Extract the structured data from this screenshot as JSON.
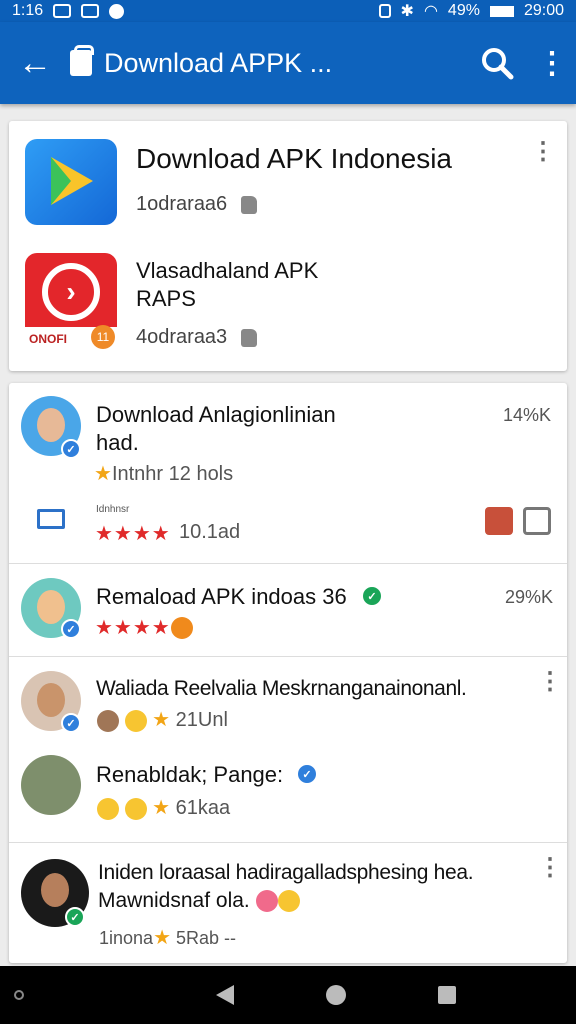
{
  "status_bar": {
    "time": "1:16",
    "battery": "49%",
    "clock_right": "29:00"
  },
  "app_bar": {
    "title": "Download APPK ..."
  },
  "featured": [
    {
      "title": "Download APK Indonesia",
      "sub": "1odraraa6"
    },
    {
      "title_line1": "Vlasadhaland APK",
      "title_line2": "RAPS",
      "sub": "4odraraa3",
      "icon_text": "ONOFI",
      "icon_badge": "11"
    }
  ],
  "feed": [
    {
      "title_line1": "Download Anlagionlinian",
      "title_line2": "had.",
      "count": "14%K",
      "tag_text": "Intnhr 12 hols",
      "small_label": "Idnhnsr",
      "stars": "★★★★",
      "rating_text": "10.1ad"
    },
    {
      "title": "Remaload APK indoas",
      "title_suffix": "36",
      "count": "29%K",
      "stars": "★★★★"
    },
    {
      "title": "Waliada Reelvalia Meskrnanganainonanl.",
      "meta": "21Unl"
    },
    {
      "title": "Renabldak; Pange:",
      "meta": "61kaa"
    },
    {
      "title_line1": "Iniden loraasal hadiragalladsphesing hea.",
      "title_line2": "Mawnidsnaf ola.",
      "meta_prefix": "1inona",
      "meta": "5Rab --"
    }
  ]
}
